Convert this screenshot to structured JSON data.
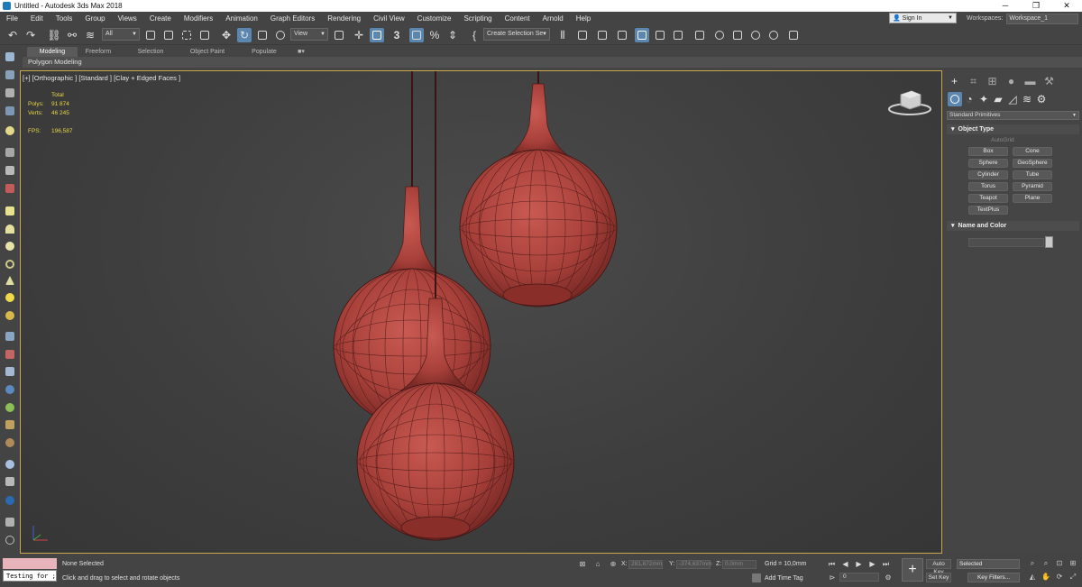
{
  "window": {
    "title": "Untitled - Autodesk 3ds Max 2018",
    "minimize": "─",
    "maximize": "❐",
    "close": "✕"
  },
  "menu": [
    "File",
    "Edit",
    "Tools",
    "Group",
    "Views",
    "Create",
    "Modifiers",
    "Animation",
    "Graph Editors",
    "Rendering",
    "Civil View",
    "Customize",
    "Scripting",
    "Content",
    "Arnold",
    "Help"
  ],
  "account": {
    "signin_label": "Sign In",
    "workspaces_label": "Workspaces:",
    "workspace_value": "Workspace_1"
  },
  "toolbar": {
    "selection_filter": "All",
    "ref_coord": "View",
    "named_selection": "Create Selection Se",
    "snap_label": "3",
    "percent_label": "%"
  },
  "ribbon": {
    "tabs": [
      "Modeling",
      "Freeform",
      "Selection",
      "Object Paint",
      "Populate"
    ],
    "active_tab": "Modeling",
    "panel_label": "Polygon Modeling"
  },
  "viewport": {
    "label": "[+] [Orthographic ] [Standard ] [Clay + Edged Faces ]",
    "stats": {
      "header": "Total",
      "polys_label": "Polys:",
      "polys_value": "91 874",
      "verts_label": "Verts:",
      "verts_value": "46 245",
      "fps_label": "FPS:",
      "fps_value": "196,587"
    },
    "object_color": "#b2443e"
  },
  "command_panel": {
    "category": "Standard Primitives",
    "object_type_title": "Object Type",
    "autogrid": "AutoGrid",
    "buttons": [
      "Box",
      "Cone",
      "Sphere",
      "GeoSphere",
      "Cylinder",
      "Tube",
      "Torus",
      "Pyramid",
      "Teapot",
      "Plane",
      "TextPlus"
    ],
    "name_color_title": "Name and Color"
  },
  "status": {
    "maxscript_text": "Testing for ;",
    "selection": "None Selected",
    "prompt": "Click and drag to select and rotate objects",
    "x_label": "X:",
    "x_value": "281,872mm",
    "y_label": "Y:",
    "y_value": "-374,637mm",
    "z_label": "Z:",
    "z_value": "0,0mm",
    "grid": "Grid = 10,0mm",
    "add_time_tag": "Add Time Tag",
    "frame": "0",
    "auto_key": "Auto Key",
    "set_key": "Set Key",
    "selected": "Selected",
    "key_filters": "Key Filters..."
  }
}
